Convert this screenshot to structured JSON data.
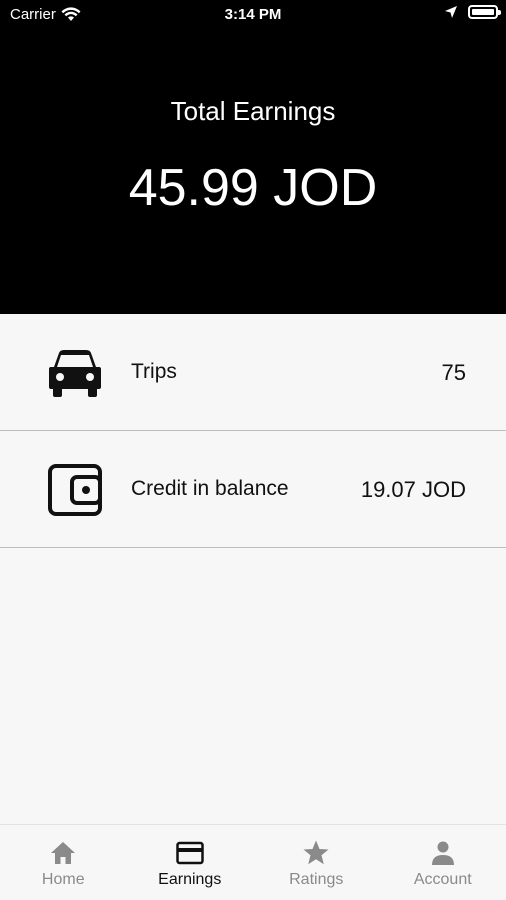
{
  "status_bar": {
    "carrier": "Carrier",
    "time": "3:14 PM"
  },
  "header": {
    "title": "Total Earnings",
    "amount": "45.99 JOD"
  },
  "rows": [
    {
      "icon": "car-icon",
      "label": "Trips",
      "value": "75"
    },
    {
      "icon": "wallet-icon",
      "label": "Credit in balance",
      "value": "19.07 JOD"
    }
  ],
  "tabs": [
    {
      "icon": "home-icon",
      "label": "Home",
      "active": false
    },
    {
      "icon": "card-icon",
      "label": "Earnings",
      "active": true
    },
    {
      "icon": "star-icon",
      "label": "Ratings",
      "active": false
    },
    {
      "icon": "person-icon",
      "label": "Account",
      "active": false
    }
  ],
  "colors": {
    "header_bg": "#000000",
    "active_tab": "#111111",
    "inactive_tab": "#8a8a8a"
  }
}
